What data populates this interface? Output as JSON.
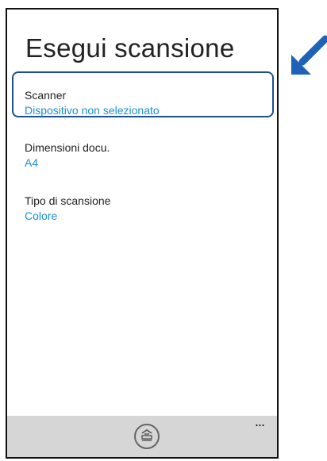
{
  "page": {
    "title": "Esegui scansione"
  },
  "settings": {
    "scanner": {
      "label": "Scanner",
      "value": "Dispositivo non selezionato"
    },
    "document_size": {
      "label": "Dimensioni docu.",
      "value": "A4"
    },
    "scan_type": {
      "label": "Tipo di scansione",
      "value": "Colore"
    }
  },
  "app_bar": {
    "more_label": "..."
  },
  "icons": {
    "scan": "scan-icon",
    "more": "more-options-icon",
    "arrow": "arrow-icon"
  },
  "colors": {
    "accent": "#1b8fd3",
    "highlight": "#1f4f8c",
    "app_bar": "#d6d6d6"
  }
}
